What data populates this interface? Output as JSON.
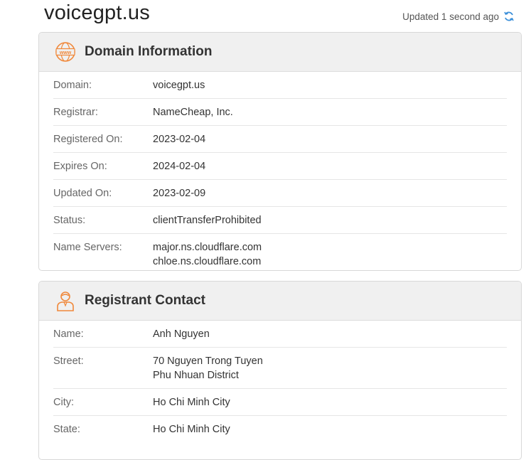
{
  "header": {
    "domain_title": "voicegpt.us",
    "updated_text": "Updated 1 second ago"
  },
  "domain_info": {
    "title": "Domain Information",
    "rows": [
      {
        "label": "Domain:",
        "values": [
          "voicegpt.us"
        ]
      },
      {
        "label": "Registrar:",
        "values": [
          "NameCheap, Inc."
        ]
      },
      {
        "label": "Registered On:",
        "values": [
          "2023-02-04"
        ]
      },
      {
        "label": "Expires On:",
        "values": [
          "2024-02-04"
        ]
      },
      {
        "label": "Updated On:",
        "values": [
          "2023-02-09"
        ]
      },
      {
        "label": "Status:",
        "values": [
          "clientTransferProhibited"
        ]
      },
      {
        "label": "Name Servers:",
        "values": [
          "major.ns.cloudflare.com",
          "chloe.ns.cloudflare.com"
        ]
      }
    ]
  },
  "registrant": {
    "title": "Registrant Contact",
    "rows": [
      {
        "label": "Name:",
        "values": [
          "Anh Nguyen"
        ]
      },
      {
        "label": "Street:",
        "values": [
          "70 Nguyen Trong Tuyen",
          "Phu Nhuan District"
        ]
      },
      {
        "label": "City:",
        "values": [
          "Ho Chi Minh City"
        ]
      },
      {
        "label": "State:",
        "values": [
          "Ho Chi Minh City"
        ]
      }
    ]
  },
  "icons": {
    "www": "www-globe-icon",
    "person": "person-icon",
    "refresh": "refresh-icon"
  },
  "colors": {
    "accent_orange": "#f0883a",
    "refresh_blue": "#3b8fd9"
  }
}
